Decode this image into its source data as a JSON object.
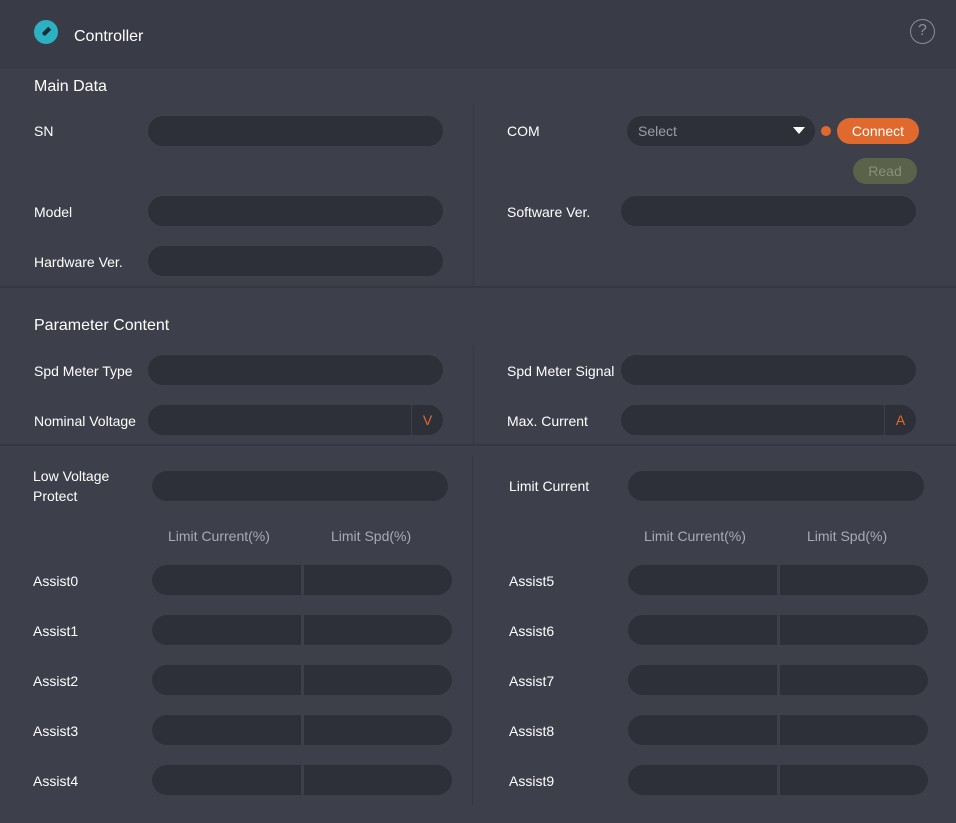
{
  "header": {
    "title": "Controller",
    "logo_icon": "rocket-icon",
    "help_icon": "?"
  },
  "main_data": {
    "title": "Main Data",
    "sn_label": "SN",
    "model_label": "Model",
    "hardware_label": "Hardware Ver.",
    "com_label": "COM",
    "com_placeholder": "Select",
    "connect_label": "Connect",
    "read_label": "Read",
    "software_label": "Software Ver."
  },
  "parameter": {
    "title": "Parameter Content",
    "spd_meter_type_label": "Spd Meter Type",
    "nominal_voltage_label": "Nominal Voltage",
    "nominal_voltage_unit": "V",
    "spd_meter_signal_label": "Spd Meter Signal",
    "max_current_label": "Max. Current",
    "max_current_unit": "A"
  },
  "assist": {
    "low_voltage_label_line1": "Low Voltage",
    "low_voltage_label_line2": "Protect",
    "limit_current_label": "Limit Current",
    "col_limit_current": "Limit Current(%)",
    "col_limit_spd": "Limit Spd(%)",
    "left_levels": [
      "Assist0",
      "Assist1",
      "Assist2",
      "Assist3",
      "Assist4"
    ],
    "right_levels": [
      "Assist5",
      "Assist6",
      "Assist7",
      "Assist8",
      "Assist9"
    ]
  },
  "colors": {
    "accent": "#e06a2d",
    "logo": "#2bb1c2",
    "background": "#393c46",
    "field": "#2e3039"
  }
}
